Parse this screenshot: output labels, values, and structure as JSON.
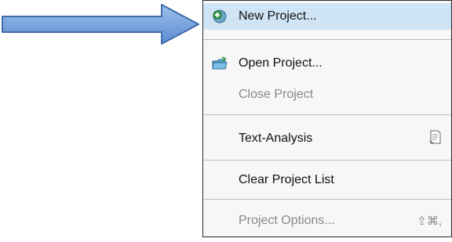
{
  "menu": {
    "items": [
      {
        "label": "New Project...",
        "icon": "new-project-icon",
        "state": "highlighted"
      },
      {
        "label": "Open Project...",
        "icon": "open-project-icon",
        "state": "enabled"
      },
      {
        "label": "Close Project",
        "state": "disabled"
      },
      {
        "label": "Text-Analysis",
        "right_icon": "text-analysis-icon",
        "state": "enabled"
      },
      {
        "label": "Clear Project List",
        "state": "enabled"
      },
      {
        "label": "Project Options...",
        "shortcut": "⇧⌘,",
        "state": "disabled"
      }
    ]
  },
  "colors": {
    "arrow_fill": "#6f9fd8",
    "highlight": "#cfe5f5",
    "menu_bg": "#f7f7f7",
    "disabled_text": "#888888"
  }
}
